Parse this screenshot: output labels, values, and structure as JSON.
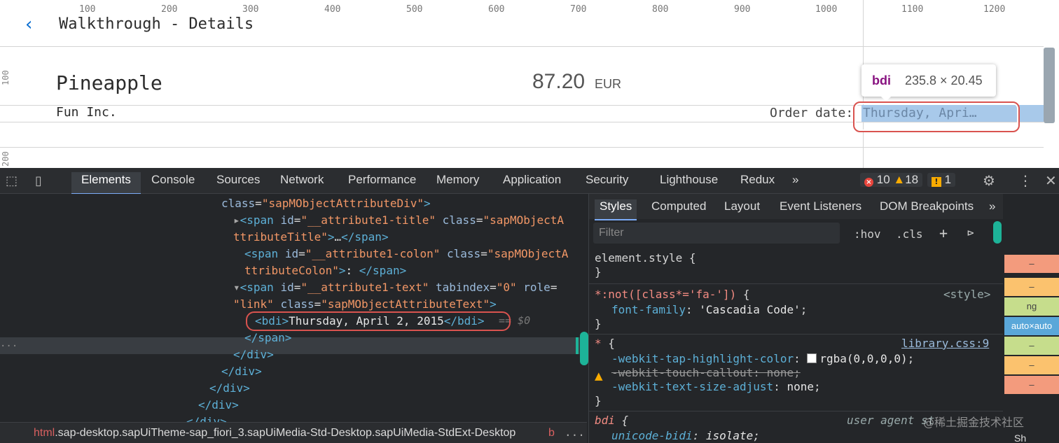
{
  "app": {
    "ruler_top": [
      "100",
      "200",
      "300",
      "400",
      "500",
      "600",
      "700",
      "800",
      "900",
      "1000",
      "1100",
      "1200"
    ],
    "ruler_left": [
      "100",
      "200"
    ],
    "back_icon": "chevron-left-icon",
    "title": "Walkthrough - Details",
    "product_name": "Pineapple",
    "price": "87.20",
    "currency": "EUR",
    "company": "Fun Inc.",
    "order_label": "Order date:",
    "order_value": "Thursday, Apri…",
    "tooltip": {
      "tag": "bdi",
      "dims": "235.8 × 20.45"
    }
  },
  "devtools": {
    "tabs": [
      "Elements",
      "Console",
      "Sources",
      "Network",
      "Performance",
      "Memory",
      "Application",
      "Security",
      "Lighthouse",
      "Redux",
      "»"
    ],
    "active_tab": "Elements",
    "counts": {
      "errors": "10",
      "warnings": "18",
      "issues": "1"
    },
    "elements_lines": {
      "l1_attr": "class",
      "l1_val": "\"sapMObjectAttributeDiv\"",
      "l2_a": "id",
      "l2_av": "\"__attribute1-title\"",
      "l2_b": "class",
      "l2_bv": "\"sapMObjectA",
      "l2_cont": "ttributeTitle\"",
      "l3_a": "id",
      "l3_av": "\"__attribute1-colon\"",
      "l3_b": "class",
      "l3_bv": "\"sapMObjectA",
      "l4_cont": "ttributeColon\"",
      "l4_text": ":",
      "l5_a": "id",
      "l5_av": "\"__attribute1-text\"",
      "l5_b": "tabindex",
      "l5_bv": "\"0\"",
      "l5_c": "role",
      "l6_cv": "\"link\"",
      "l6_d": "class",
      "l6_dv": "\"sapMObjectAttributeText\"",
      "l7_text": "Thursday, April 2, 2015",
      "l7_eq": "== $0"
    },
    "breadcrumb": {
      "tag": "html",
      "classes": ".sap-desktop.sapUiTheme-sap_fiori_3.sapUiMedia-Std-Desktop.sapUiMedia-StdExt-Desktop",
      "next": "b",
      "more": "..."
    },
    "styles": {
      "tabs": [
        "Styles",
        "Computed",
        "Layout",
        "Event Listeners",
        "DOM Breakpoints",
        "»"
      ],
      "active_tab": "Styles",
      "filter_placeholder": "Filter",
      "hov": ":hov",
      "cls": ".cls",
      "plus": "+",
      "rules": {
        "r1_sel": "element.style",
        "r2_sel": "*:not([class*='fa-'])",
        "r2_src": "<style>",
        "r2_p1": "font-family",
        "r2_v1": "'Cascadia Code'",
        "r3_sel": "*",
        "r3_src": "library.css:9",
        "r3_p1": "-webkit-tap-highlight-color",
        "r3_v1": "rgba(0,0,0,0)",
        "r3_p2": "-webkit-touch-callout",
        "r3_v2": "none",
        "r3_p3": "-webkit-text-size-adjust",
        "r3_v3": "none",
        "r4_sel": "bdi",
        "r4_src": "user agent st",
        "r4_p1": "unicode-bidi",
        "r4_v1": "isolate"
      }
    },
    "strip": {
      "cells": [
        "–",
        "–",
        "ng",
        "auto×auto",
        "–",
        "–",
        "–"
      ],
      "bottom": "Sh"
    },
    "watermark": "@稀土掘金技术社区"
  },
  "colors": {
    "accent_blue": "#0a6ed1",
    "highlight_ring": "#d9534f",
    "devtools_bg": "#242629",
    "tag_color": "#5db0d7",
    "attr_value_color": "#f29766"
  }
}
